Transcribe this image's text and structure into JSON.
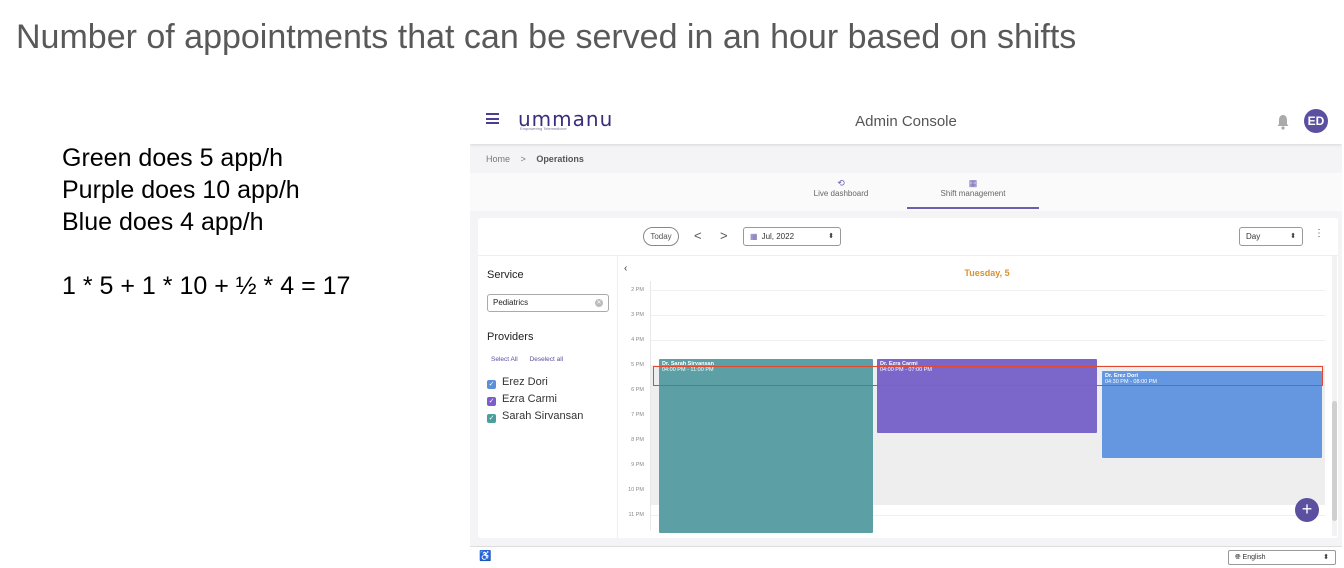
{
  "slide": {
    "title": "Number of appointments that can be served in an hour based on shifts",
    "notes": [
      "Green does 5 app/h",
      "Purple does 10 app/h",
      "Blue does 4 app/h"
    ],
    "formula": "1 * 5 + 1 * 10 + ½ * 4 = 17"
  },
  "app": {
    "logo": "ummanu",
    "logo_tagline": "Empowering Telemedicine",
    "title": "Admin Console",
    "avatar_initials": "ED",
    "breadcrumb": {
      "home": "Home",
      "separator": ">",
      "current": "Operations"
    },
    "tabs": [
      {
        "label": "Live dashboard",
        "icon": "refresh-icon"
      },
      {
        "label": "Shift management",
        "icon": "calendar-icon"
      }
    ],
    "toolbar": {
      "today": "Today",
      "prev": "<",
      "next": ">",
      "month": "Jul, 2022",
      "view": "Day"
    },
    "sidebar": {
      "service_label": "Service",
      "service_value": "Pediatrics",
      "providers_label": "Providers",
      "select_all": "Select All",
      "deselect_all": "Deselect all",
      "providers": [
        {
          "name": "Erez Dori",
          "color": "#5b8fd8"
        },
        {
          "name": "Ezra Carmi",
          "color": "#7b5fc8"
        },
        {
          "name": "Sarah Sirvansan",
          "color": "#4a9e9e"
        }
      ]
    },
    "calendar": {
      "day_heading": "Tuesday, 5",
      "time_labels": [
        "2 PM",
        "3 PM",
        "4 PM",
        "5 PM",
        "6 PM",
        "7 PM",
        "8 PM",
        "9 PM",
        "10 PM",
        "11 PM"
      ],
      "shifts": [
        {
          "doctor": "Dr. Sarah Sirvansan",
          "time": "04:00 PM - 11:00 PM",
          "color": "#5ca0a5"
        },
        {
          "doctor": "Dr. Ezra Carmi",
          "time": "04:00 PM - 07:00 PM",
          "color": "#7b66c9"
        },
        {
          "doctor": "Dr. Erez Dori",
          "time": "04:30 PM - 08:00 PM",
          "color": "#6497e0"
        }
      ]
    },
    "fab": "+",
    "footer": {
      "language": "English"
    }
  }
}
